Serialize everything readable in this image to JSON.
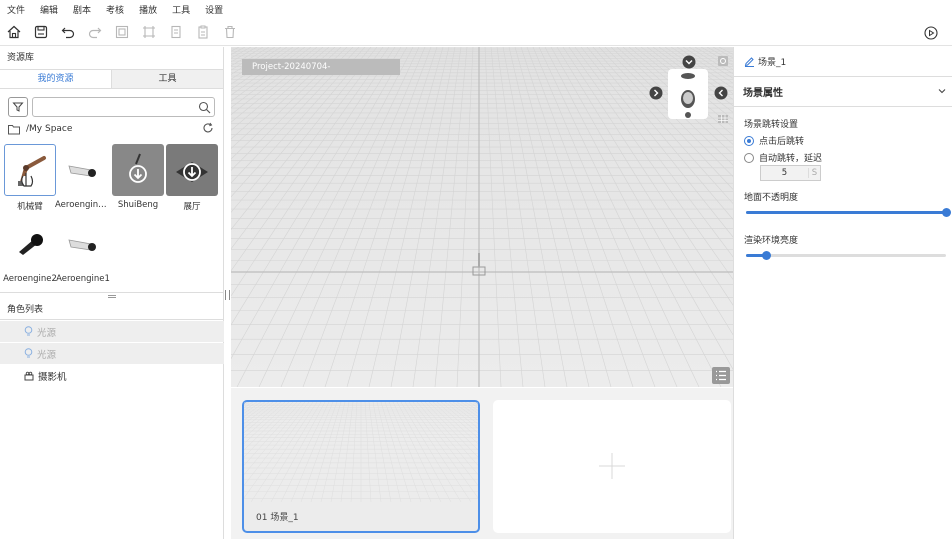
{
  "menu": [
    "文件",
    "编辑",
    "剧本",
    "考核",
    "播放",
    "工具",
    "设置"
  ],
  "left": {
    "title": "资源库",
    "tabs": [
      "我的资源",
      "工具"
    ],
    "search_placeholder": "",
    "path": "/My Space",
    "assets": [
      {
        "name": "机械臂",
        "icon": "robot-arm-icon"
      },
      {
        "name": "Aeroengine…",
        "icon": "aeroengine-icon"
      },
      {
        "name": "ShuiBeng",
        "icon": "download-icon"
      },
      {
        "name": "展厅",
        "icon": "download-icon"
      },
      {
        "name": "Aeroengine2",
        "icon": "engine-black-icon"
      },
      {
        "name": "Aeroengine1",
        "icon": "aeroengine-icon"
      }
    ],
    "roles_title": "角色列表",
    "roles": [
      {
        "name": "光源",
        "icon": "bulb-icon"
      },
      {
        "name": "光源",
        "icon": "bulb-icon"
      },
      {
        "name": "摄影机",
        "icon": "camera-icon"
      }
    ]
  },
  "viewport": {
    "project_label": "Project-20240704-"
  },
  "scenes": [
    {
      "label": "01  场景_1"
    }
  ],
  "right": {
    "scene_name": "场景_1",
    "section_title": "场景属性",
    "jump_setting_label": "场景跳转设置",
    "options": [
      "点击后跳转",
      "自动跳转，延迟"
    ],
    "selected_option": 0,
    "delay_value": "5",
    "delay_unit": "S",
    "ground_opacity_label": "地面不透明度",
    "ground_opacity": 1.0,
    "env_brightness_label": "渲染环境亮度",
    "env_brightness": 0.1
  },
  "colors": {
    "accent": "#3a7bd5",
    "viewport_bg": "#e8e8e8"
  }
}
